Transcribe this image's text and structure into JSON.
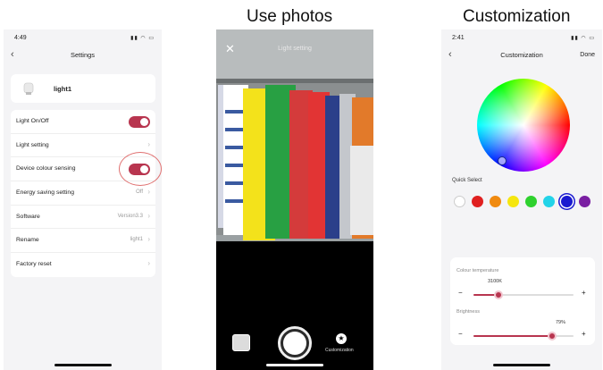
{
  "captions": {
    "photos": "Use photos",
    "custom": "Customization"
  },
  "settings_screen": {
    "time": "4:49",
    "status_icons": "signal-wifi-battery",
    "title": "Settings",
    "device_name": "light1",
    "rows": [
      {
        "label": "Light On/Off",
        "type": "toggle",
        "on": true
      },
      {
        "label": "Light setting",
        "value": ""
      },
      {
        "label": "Device colour sensing",
        "type": "toggle",
        "on": true
      },
      {
        "label": "Energy saving setting",
        "value": "Off"
      },
      {
        "label": "Software",
        "value": "Version3.3"
      },
      {
        "label": "Rename",
        "value": "light1"
      },
      {
        "label": "Factory reset",
        "value": ""
      }
    ],
    "accent": "#b8354f"
  },
  "camera_screen": {
    "title": "Light setting",
    "custom_label": "Customization"
  },
  "custom_screen": {
    "time": "2:41",
    "title": "Customization",
    "done": "Done",
    "quick_select": "Quick Select",
    "swatches": [
      "#ffffff",
      "#e02020",
      "#f08a10",
      "#f5e60f",
      "#2ed12e",
      "#22d3e8",
      "#1a1ad0",
      "#7a1fa2"
    ],
    "selected_swatch": 6,
    "colour_temperature_label": "Colour temperature",
    "colour_temperature_value": "3100K",
    "colour_temperature_fraction": 0.25,
    "brightness_label": "Brightness",
    "brightness_value": "79%",
    "brightness_fraction": 0.79,
    "minus": "−",
    "plus": "+"
  }
}
